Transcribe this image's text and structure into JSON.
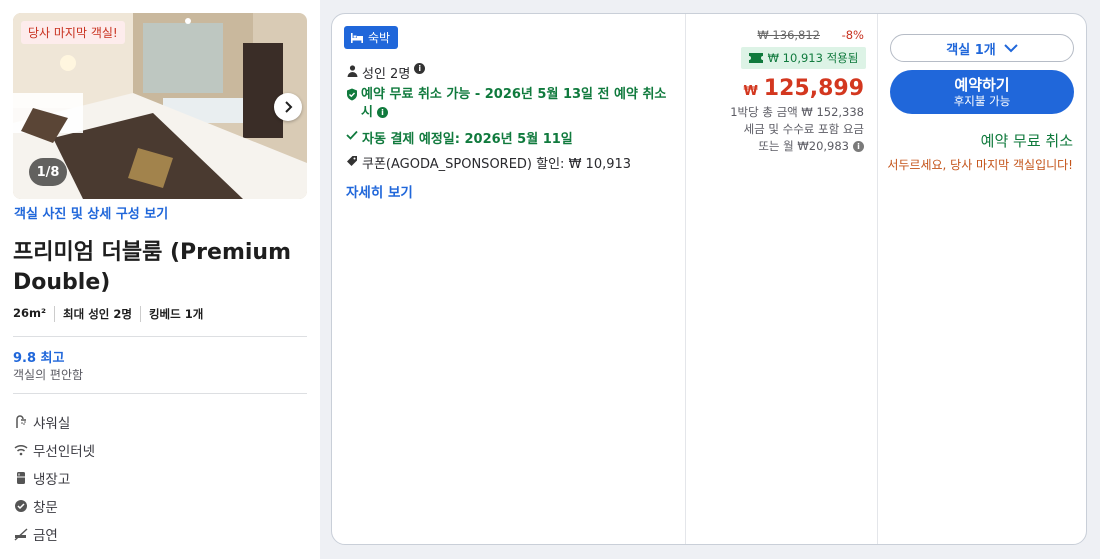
{
  "room": {
    "photo_badge": "당사 마지막 객실!",
    "photo_counter": "1/8",
    "gallery_link": "객실 사진 및 상세 구성 보기",
    "title": "프리미엄 더블룸 (Premium Double)",
    "specs": [
      "26m²",
      "최대 성인 2명",
      "킹베드 1개"
    ],
    "score": "9.8 최고",
    "score_label": "객실의 편안함",
    "amenities": [
      {
        "label": "샤워실",
        "icon": "shower-icon"
      },
      {
        "label": "무선인터넷",
        "icon": "wifi-icon"
      },
      {
        "label": "냉장고",
        "icon": "fridge-icon"
      },
      {
        "label": "창문",
        "icon": "window-check-icon"
      },
      {
        "label": "금연",
        "icon": "no-smoking-icon"
      }
    ]
  },
  "offer": {
    "tag": "숙박",
    "guests": "성인 2명",
    "free_cancel_note": "예약 무료 취소 가능 - 2026년 5월 13일 전 예약 취소 시",
    "auto_payment": "자동 결제 예정일: 2026년 5월 11일",
    "coupon": "쿠폰(AGODA_SPONSORED) 할인: ₩ 10,913",
    "details_link": "자세히 보기"
  },
  "price": {
    "original": "₩ 136,812",
    "discount": "-8%",
    "coupon_applied": "₩ 10,913 적용됨",
    "currency": "₩",
    "amount": "125,899",
    "per_night_total": "1박당 총 금액 ₩ 152,338",
    "taxes_note": "세금 및 수수료 포함 요금",
    "monthly": "또는 월 ₩20,983"
  },
  "booking": {
    "room_select": "객실 1개",
    "book_label": "예약하기",
    "book_sub": "후지불 가능",
    "free_cancel": "예약 무료 취소",
    "hurry": "서두르세요, 당사 마지막 객실입니다!"
  },
  "colors": {
    "accent_blue": "#2067da",
    "price_red": "#d3371f",
    "success_green": "#107a3d",
    "warning_orange": "#c4541a"
  }
}
